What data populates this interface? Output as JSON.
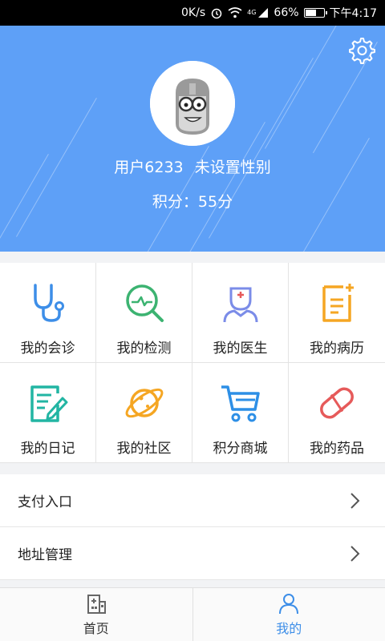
{
  "status_bar": {
    "speed": "0K/s",
    "battery_percent": "66%",
    "time": "下午4:17",
    "network": "4G",
    "battery_level": 0.66
  },
  "header": {
    "username": "用户6233",
    "gender": "未设置性别",
    "points": "积分：55分",
    "bg_color": "#5ea0f7"
  },
  "grid": {
    "items": [
      {
        "label": "我的会诊",
        "icon": "stethoscope-icon",
        "color": "#3d8ee8"
      },
      {
        "label": "我的检测",
        "icon": "magnifier-pulse-icon",
        "color": "#3cb371"
      },
      {
        "label": "我的医生",
        "icon": "doctor-icon",
        "color": "#7b8ce8"
      },
      {
        "label": "我的病历",
        "icon": "medical-record-icon",
        "color": "#f5a623"
      },
      {
        "label": "我的日记",
        "icon": "diary-icon",
        "color": "#22b5a3"
      },
      {
        "label": "我的社区",
        "icon": "planet-icon",
        "color": "#f5a623"
      },
      {
        "label": "积分商城",
        "icon": "cart-icon",
        "color": "#2d8fe6"
      },
      {
        "label": "我的药品",
        "icon": "pill-icon",
        "color": "#e65a5a"
      }
    ]
  },
  "list": {
    "items": [
      {
        "label": "支付入口"
      },
      {
        "label": "地址管理"
      }
    ]
  },
  "tabbar": {
    "tabs": [
      {
        "label": "首页",
        "icon": "home-building-icon",
        "active": false
      },
      {
        "label": "我的",
        "icon": "profile-icon",
        "active": true
      }
    ],
    "active_color": "#3d8ee8",
    "inactive_color": "#333333"
  }
}
